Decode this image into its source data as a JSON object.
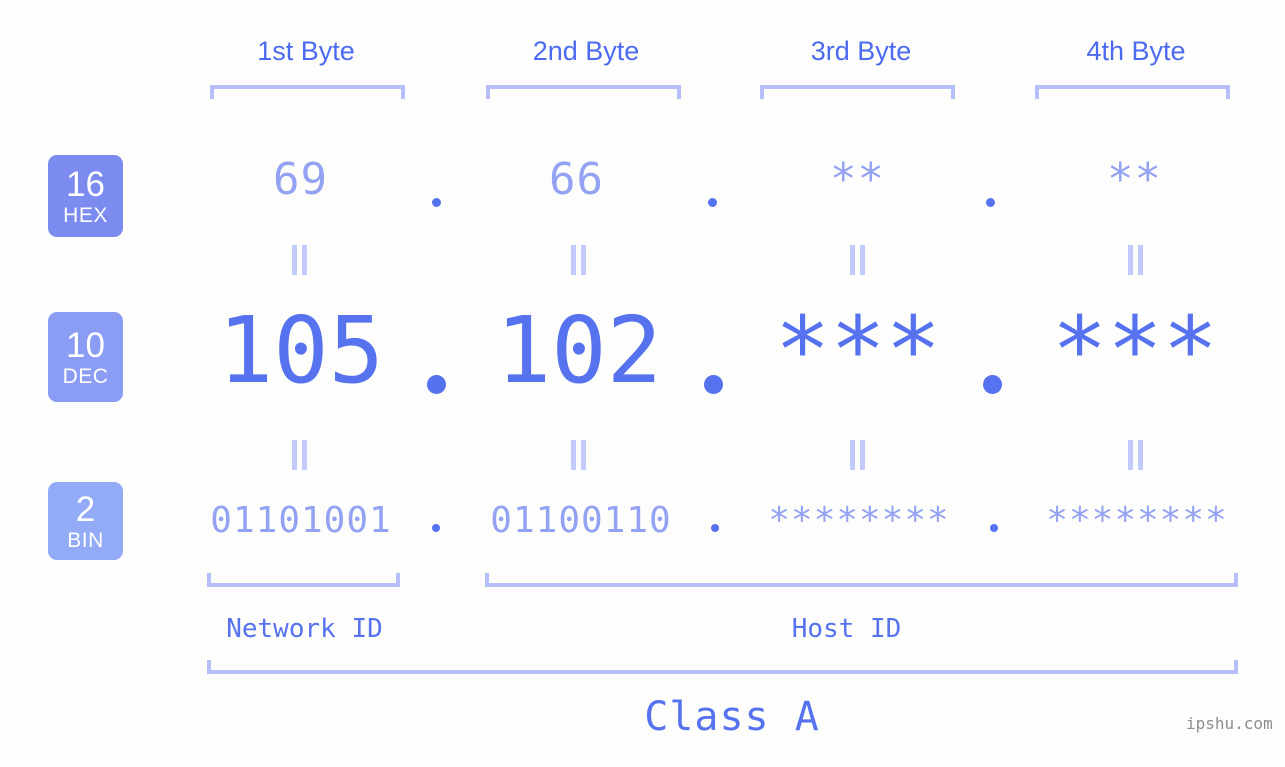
{
  "meta": {
    "watermark": "ipshu.com",
    "background_color": "#fdfefb",
    "accent_color": "#5672ee",
    "light_accent_color": "#93a2f2",
    "bracket_color": "#b6bffa"
  },
  "byte_headers": [
    {
      "label": "1st Byte"
    },
    {
      "label": "2nd Byte"
    },
    {
      "label": "3rd Byte"
    },
    {
      "label": "4th Byte"
    }
  ],
  "bases": [
    {
      "number": "16",
      "name": "HEX",
      "color": "#7b8bf0"
    },
    {
      "number": "10",
      "name": "DEC",
      "color": "#8b9cf4"
    },
    {
      "number": "2",
      "name": "BIN",
      "color": "#93aaf7"
    }
  ],
  "rows": {
    "hex": {
      "values": [
        "69",
        "66",
        "**",
        "**"
      ],
      "separator": "."
    },
    "dec": {
      "values": [
        "105",
        "102",
        "***",
        "***"
      ],
      "separator": "."
    },
    "bin": {
      "values": [
        "01101001",
        "01100110",
        "********",
        "********"
      ],
      "separator": "."
    }
  },
  "equals_symbol": "=",
  "sections": [
    {
      "label": "Network ID"
    },
    {
      "label": "Host ID"
    }
  ],
  "class": {
    "label": "Class A"
  }
}
